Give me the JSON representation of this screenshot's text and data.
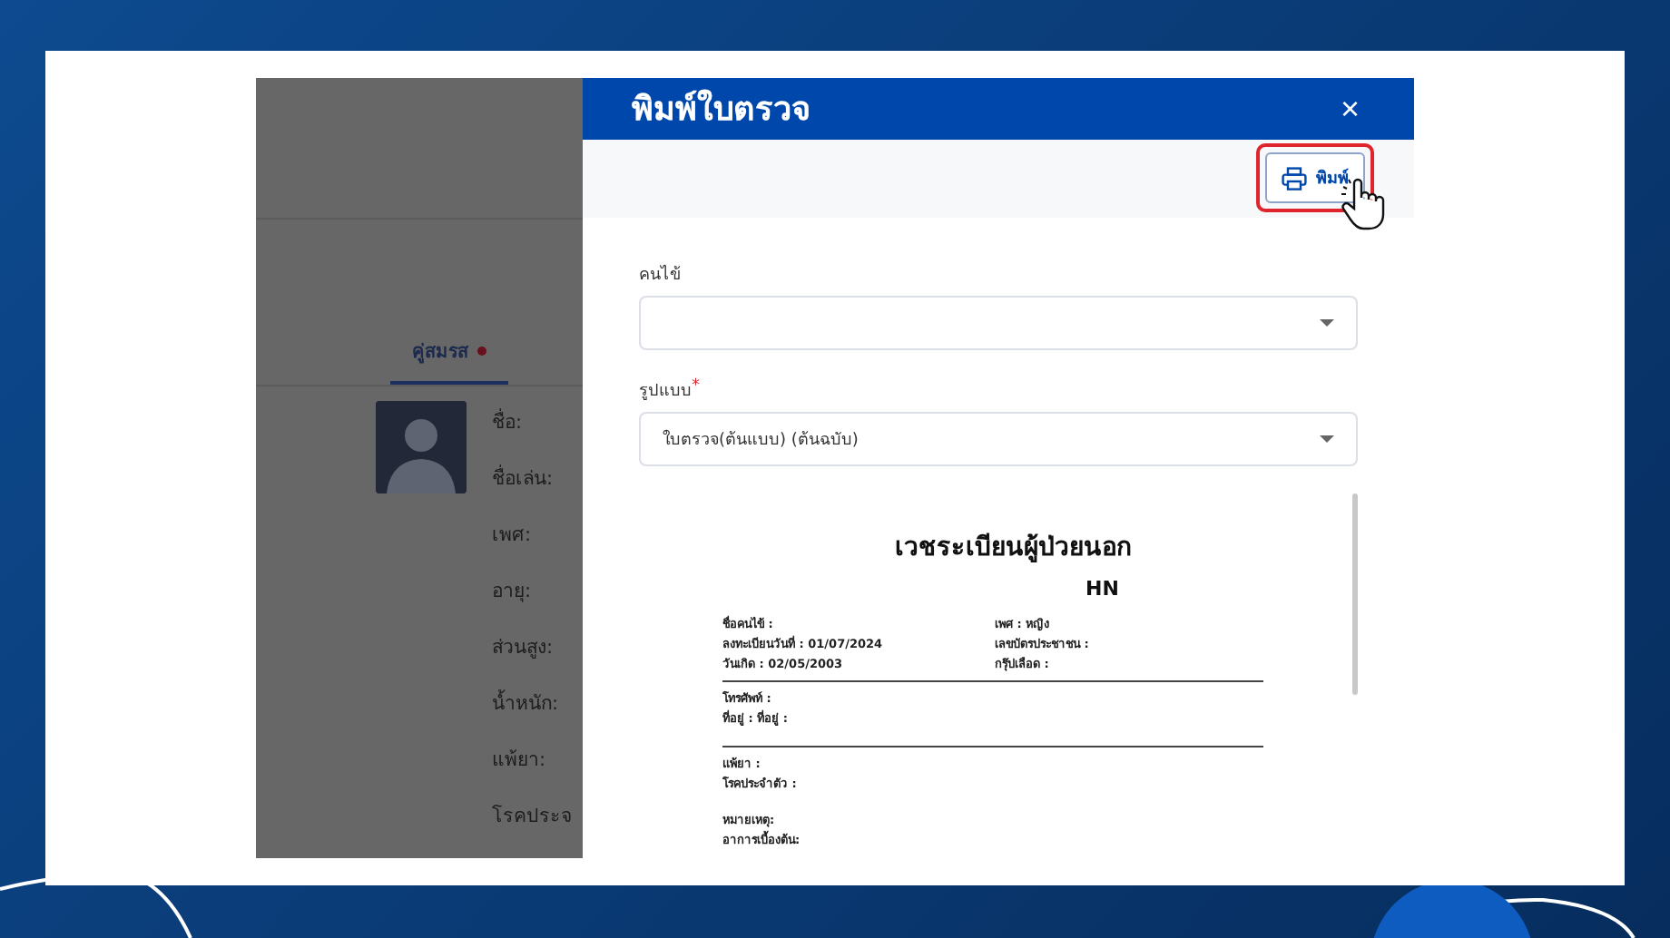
{
  "background_app": {
    "tabs": [
      {
        "label": "คู่สมรส",
        "selected": true,
        "dot": true
      }
    ],
    "profile_labels": [
      "ชื่อ:",
      "ชื่อเล่น:",
      "เพศ:",
      "อายุ:",
      "ส่วนสูง:",
      "น้ำหนัก:",
      "แพ้ยา:",
      "โรคประจ"
    ]
  },
  "dialog": {
    "title": "พิมพ์ใบตรวจ",
    "close_icon": "×",
    "print_button": {
      "label": "พิมพ์",
      "highlighted": true
    },
    "fields": [
      {
        "label": "คนไข้"
      },
      {
        "label": "รูปแบบ",
        "required_mark": "*",
        "value": "ใบตรวจ(ต้นแบบ) (ต้นฉบับ)"
      }
    ],
    "preview": {
      "title": "เวชระเบียนผู้ป่วยนอก",
      "hn_label": "HN",
      "blocks": [
        {
          "kind": "columns",
          "left": [
            "ชื่อคนไข้ :",
            "ลงทะเบียนวันที่ : 01/07/2024",
            "วันเกิด : 02/05/2003"
          ],
          "right": [
            "เพศ : หญิง",
            "เลขบัตรประชาชน :",
            "กรุ๊ปเลือด :"
          ]
        },
        {
          "kind": "rule"
        },
        {
          "kind": "lines",
          "lines": [
            "โทรศัพท์ :",
            "ที่อยู่ : ที่อยู่ :"
          ]
        },
        {
          "kind": "rule"
        },
        {
          "kind": "lines",
          "lines": [
            "แพ้ยา :",
            "โรคประจำตัว :"
          ]
        },
        {
          "kind": "lines",
          "lines": [
            "หมายเหตุ:",
            "อาการเบื้องต้น:"
          ]
        }
      ]
    }
  }
}
